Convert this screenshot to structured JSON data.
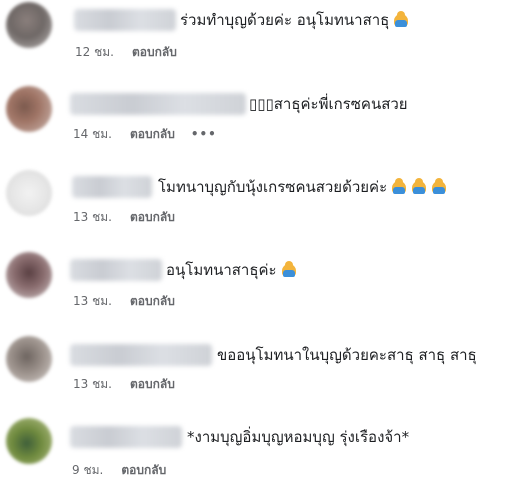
{
  "comments": [
    {
      "text": "ร่วมทำบุญด้วยค่ะ อนุโมทนาสาธุ",
      "emojis": 1,
      "time": "12 ชม.",
      "reply": "ตอบกลับ",
      "more": ""
    },
    {
      "text": "▯▯▯สาธุค่ะพี่เกรซคนสวย",
      "emojis": 0,
      "time": "14 ชม.",
      "reply": "ตอบกลับ",
      "more": "•••"
    },
    {
      "text": "โมทนาบุญกับนุ้งเกรซคนสวยด้วยค่ะ",
      "emojis": 3,
      "time": "13 ชม.",
      "reply": "ตอบกลับ",
      "more": ""
    },
    {
      "text": "อนุโมทนาสาธุค่ะ",
      "emojis": 1,
      "time": "13 ชม.",
      "reply": "ตอบกลับ",
      "more": ""
    },
    {
      "text": "ขออนุโมทนาในบุญด้วยคะสาธุ สาธุ สาธุ",
      "emojis": 0,
      "time": "13 ชม.",
      "reply": "ตอบกลับ",
      "more": ""
    },
    {
      "text": "*งามบุญอิ่มบุญหอมบุญ รุ่งเรืองจ้า*",
      "emojis": 0,
      "time": "9 ชม.",
      "reply": "ตอบกลับ",
      "more": ""
    }
  ]
}
